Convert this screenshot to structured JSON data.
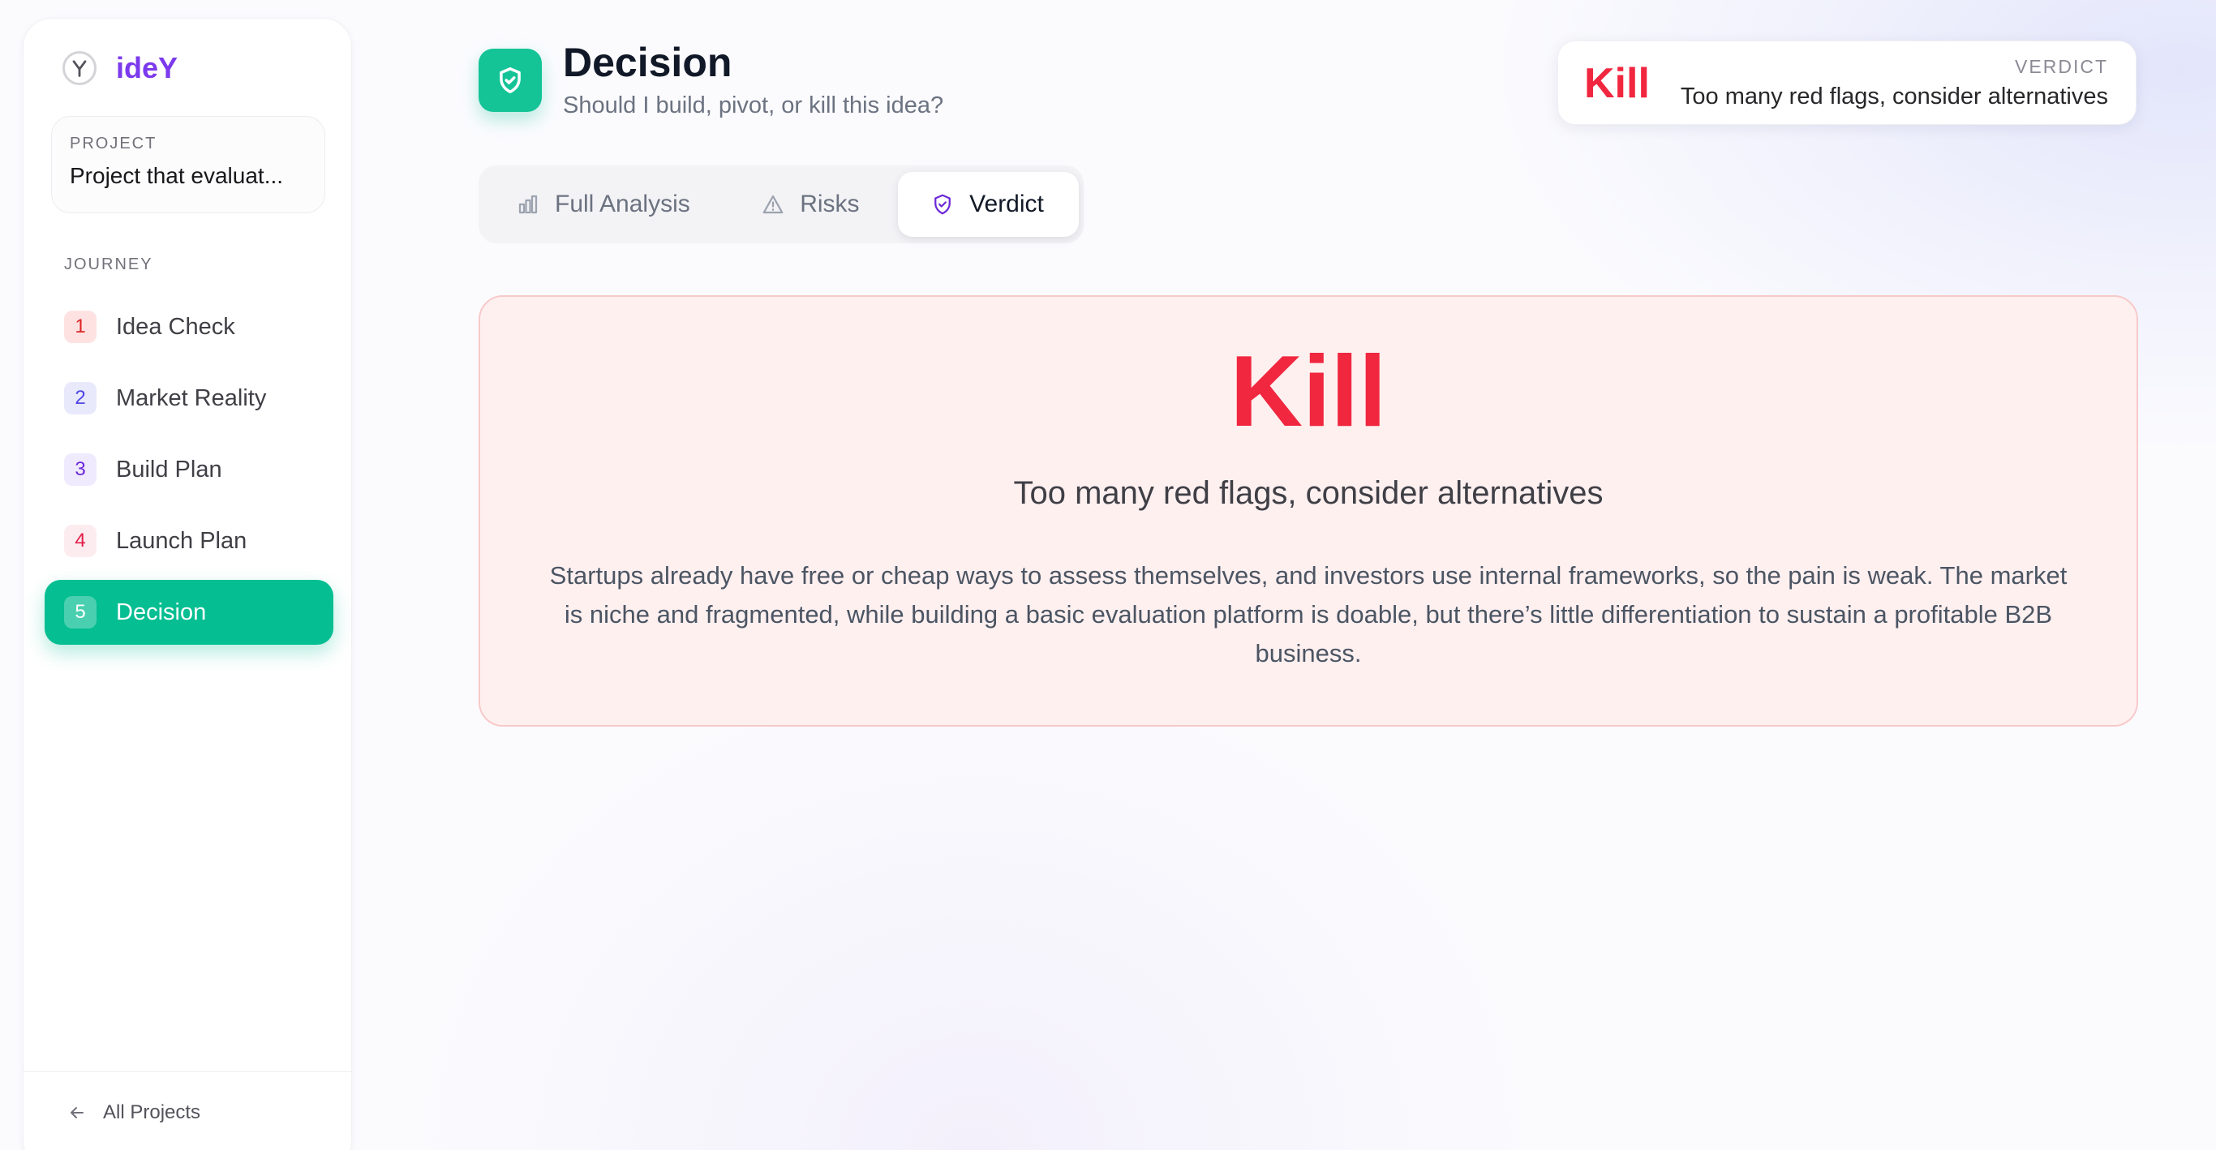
{
  "brand": {
    "name": "ideY",
    "icon": "y-logo-icon"
  },
  "project": {
    "label": "PROJECT",
    "name": "Project that evaluat..."
  },
  "journey": {
    "label": "JOURNEY",
    "items": [
      {
        "num": "1",
        "label": "Idea Check",
        "active": false
      },
      {
        "num": "2",
        "label": "Market Reality",
        "active": false
      },
      {
        "num": "3",
        "label": "Build Plan",
        "active": false
      },
      {
        "num": "4",
        "label": "Launch Plan",
        "active": false
      },
      {
        "num": "5",
        "label": "Decision",
        "active": true
      }
    ]
  },
  "footer": {
    "all_projects": "All Projects",
    "icon": "arrow-left-icon"
  },
  "header": {
    "icon": "shield-check-icon",
    "title": "Decision",
    "subtitle": "Should I build, pivot, or kill this idea?"
  },
  "verdict_badge": {
    "label": "VERDICT",
    "verdict": "Kill",
    "summary": "Too many red flags, consider alternatives"
  },
  "tabs": [
    {
      "label": "Full Analysis",
      "icon": "bar-chart-icon",
      "active": false
    },
    {
      "label": "Risks",
      "icon": "warning-triangle-icon",
      "active": false
    },
    {
      "label": "Verdict",
      "icon": "shield-icon",
      "active": true
    }
  ],
  "panel": {
    "verdict": "Kill",
    "tagline": "Too many red flags, consider alternatives",
    "body": "Startups already have free or cheap ways to assess themselves, and investors use internal frameworks, so the pain is weak. The market is niche and fragmented, while building a basic evaluation platform is doable, but there’s little differentiation to sustain a profitable B2B business."
  },
  "colors": {
    "accent_green": "#05be92",
    "brand_purple": "#7c3aed",
    "kill_red": "#f0273f",
    "panel_bg": "#fff0f0"
  }
}
